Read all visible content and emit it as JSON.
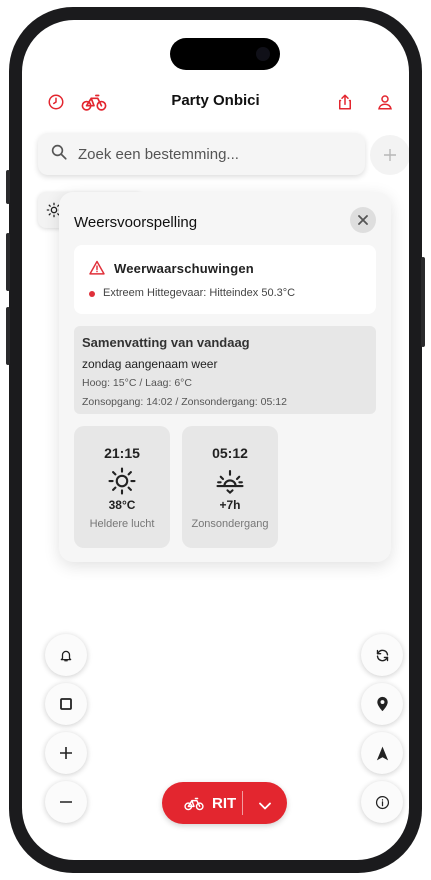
{
  "header": {
    "title": "Party Onbici"
  },
  "search": {
    "placeholder": "Zoek een bestemming..."
  },
  "forecast": {
    "title": "Weersvoorspelling",
    "warnings": {
      "title": "Weerwaarschuwingen",
      "items": [
        "Extreem Hittegevaar: Hitteindex 50.3°C"
      ]
    },
    "summary": {
      "title": "Samenvatting van vandaag",
      "subtitle": "zondag aangenaam weer",
      "high_low": "Hoog: 15°C / Laag: 6°C",
      "sun": "Zonsopgang: 14:02 / Zonsondergang: 05:12"
    },
    "hours": [
      {
        "time": "21:15",
        "icon": "sun-icon",
        "value": "38°C",
        "desc": "Heldere lucht"
      },
      {
        "time": "05:12",
        "icon": "sunset-icon",
        "value": "+7h",
        "desc": "Zonsondergang"
      }
    ]
  },
  "ride_button": {
    "label": "RIT"
  },
  "colors": {
    "accent": "#e3262f",
    "text": "#1c1c1e"
  }
}
